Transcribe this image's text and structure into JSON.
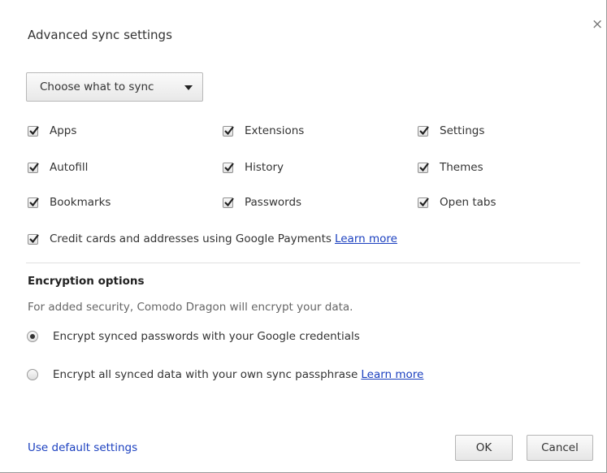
{
  "dialog": {
    "title": "Advanced sync settings",
    "close_label": "×"
  },
  "sync": {
    "dropdown_label": "Choose what to sync",
    "items": [
      {
        "label": "Apps",
        "checked": true
      },
      {
        "label": "Extensions",
        "checked": true
      },
      {
        "label": "Settings",
        "checked": true
      },
      {
        "label": "Autofill",
        "checked": true
      },
      {
        "label": "History",
        "checked": true
      },
      {
        "label": "Themes",
        "checked": true
      },
      {
        "label": "Bookmarks",
        "checked": true
      },
      {
        "label": "Passwords",
        "checked": true
      },
      {
        "label": "Open tabs",
        "checked": true
      }
    ],
    "credit_cards": {
      "label": "Credit cards and addresses using Google Payments",
      "checked": true,
      "learn_more": "Learn more"
    }
  },
  "encryption": {
    "title": "Encryption options",
    "description": "For added security, Comodo Dragon will encrypt your data.",
    "options": [
      {
        "label": "Encrypt synced passwords with your Google credentials",
        "selected": true
      },
      {
        "label": "Encrypt all synced data with your own sync passphrase",
        "selected": false,
        "learn_more": "Learn more"
      }
    ]
  },
  "footer": {
    "default_link": "Use default settings",
    "ok_label": "OK",
    "cancel_label": "Cancel"
  },
  "colors": {
    "link": "#1a3fbf",
    "text": "#333333",
    "muted": "#666666"
  },
  "icons": [
    "close-icon",
    "dropdown-arrow-icon",
    "checkmark-icon"
  ]
}
